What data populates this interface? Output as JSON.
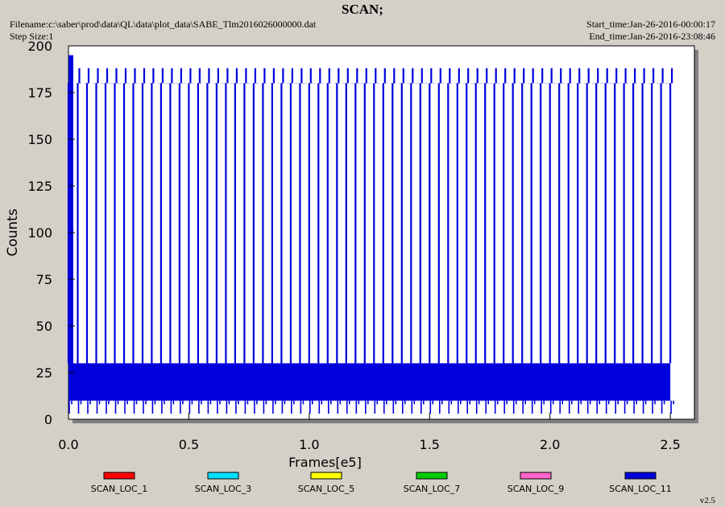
{
  "header": {
    "title": "SCAN;",
    "filename": "Filename:c:\\saber\\prod\\data\\QL\\data\\plot_data\\SABE_Tlm2016026000000.dat",
    "step_size": "Step Size:1",
    "start_time": "Start_time:Jan-26-2016-00:00:17",
    "end_time": "End_time:Jan-26-2016-23:08:46"
  },
  "version": "v2.5",
  "colors": {
    "background": "#d4d0c8",
    "plot_area": "#ffffff",
    "shadow": "#808080"
  },
  "chart_data": {
    "type": "line",
    "title": "SCAN;",
    "xlabel": "Frames[e5]",
    "ylabel": "Counts",
    "xlim": [
      0,
      2.6
    ],
    "ylim": [
      0,
      200
    ],
    "x_ticks": [
      0.0,
      0.5,
      1.0,
      1.5,
      2.0,
      2.5
    ],
    "x_tick_labels": [
      "0.0",
      "0.5",
      "1.0",
      "1.5",
      "2.0",
      "2.5"
    ],
    "y_ticks": [
      0,
      25,
      50,
      75,
      100,
      125,
      150,
      175,
      200
    ],
    "y_tick_labels": [
      "0",
      "25",
      "50",
      "75",
      "100",
      "125",
      "150",
      "175",
      "200"
    ],
    "grid": false,
    "legend_position": "bottom",
    "data_x_range": [
      0.0,
      2.5
    ],
    "baseline_band": [
      10,
      30
    ],
    "spike_high": 180,
    "spike_peak": 188,
    "spike_low": 3,
    "series": [
      {
        "name": "SCAN_LOC_1",
        "color": "#ff0000"
      },
      {
        "name": "SCAN_LOC_3",
        "color": "#00e0ff"
      },
      {
        "name": "SCAN_LOC_5",
        "color": "#ffff00"
      },
      {
        "name": "SCAN_LOC_7",
        "color": "#00cc00"
      },
      {
        "name": "SCAN_LOC_9",
        "color": "#ff66cc"
      },
      {
        "name": "SCAN_LOC_11",
        "color": "#0000dd"
      }
    ]
  }
}
